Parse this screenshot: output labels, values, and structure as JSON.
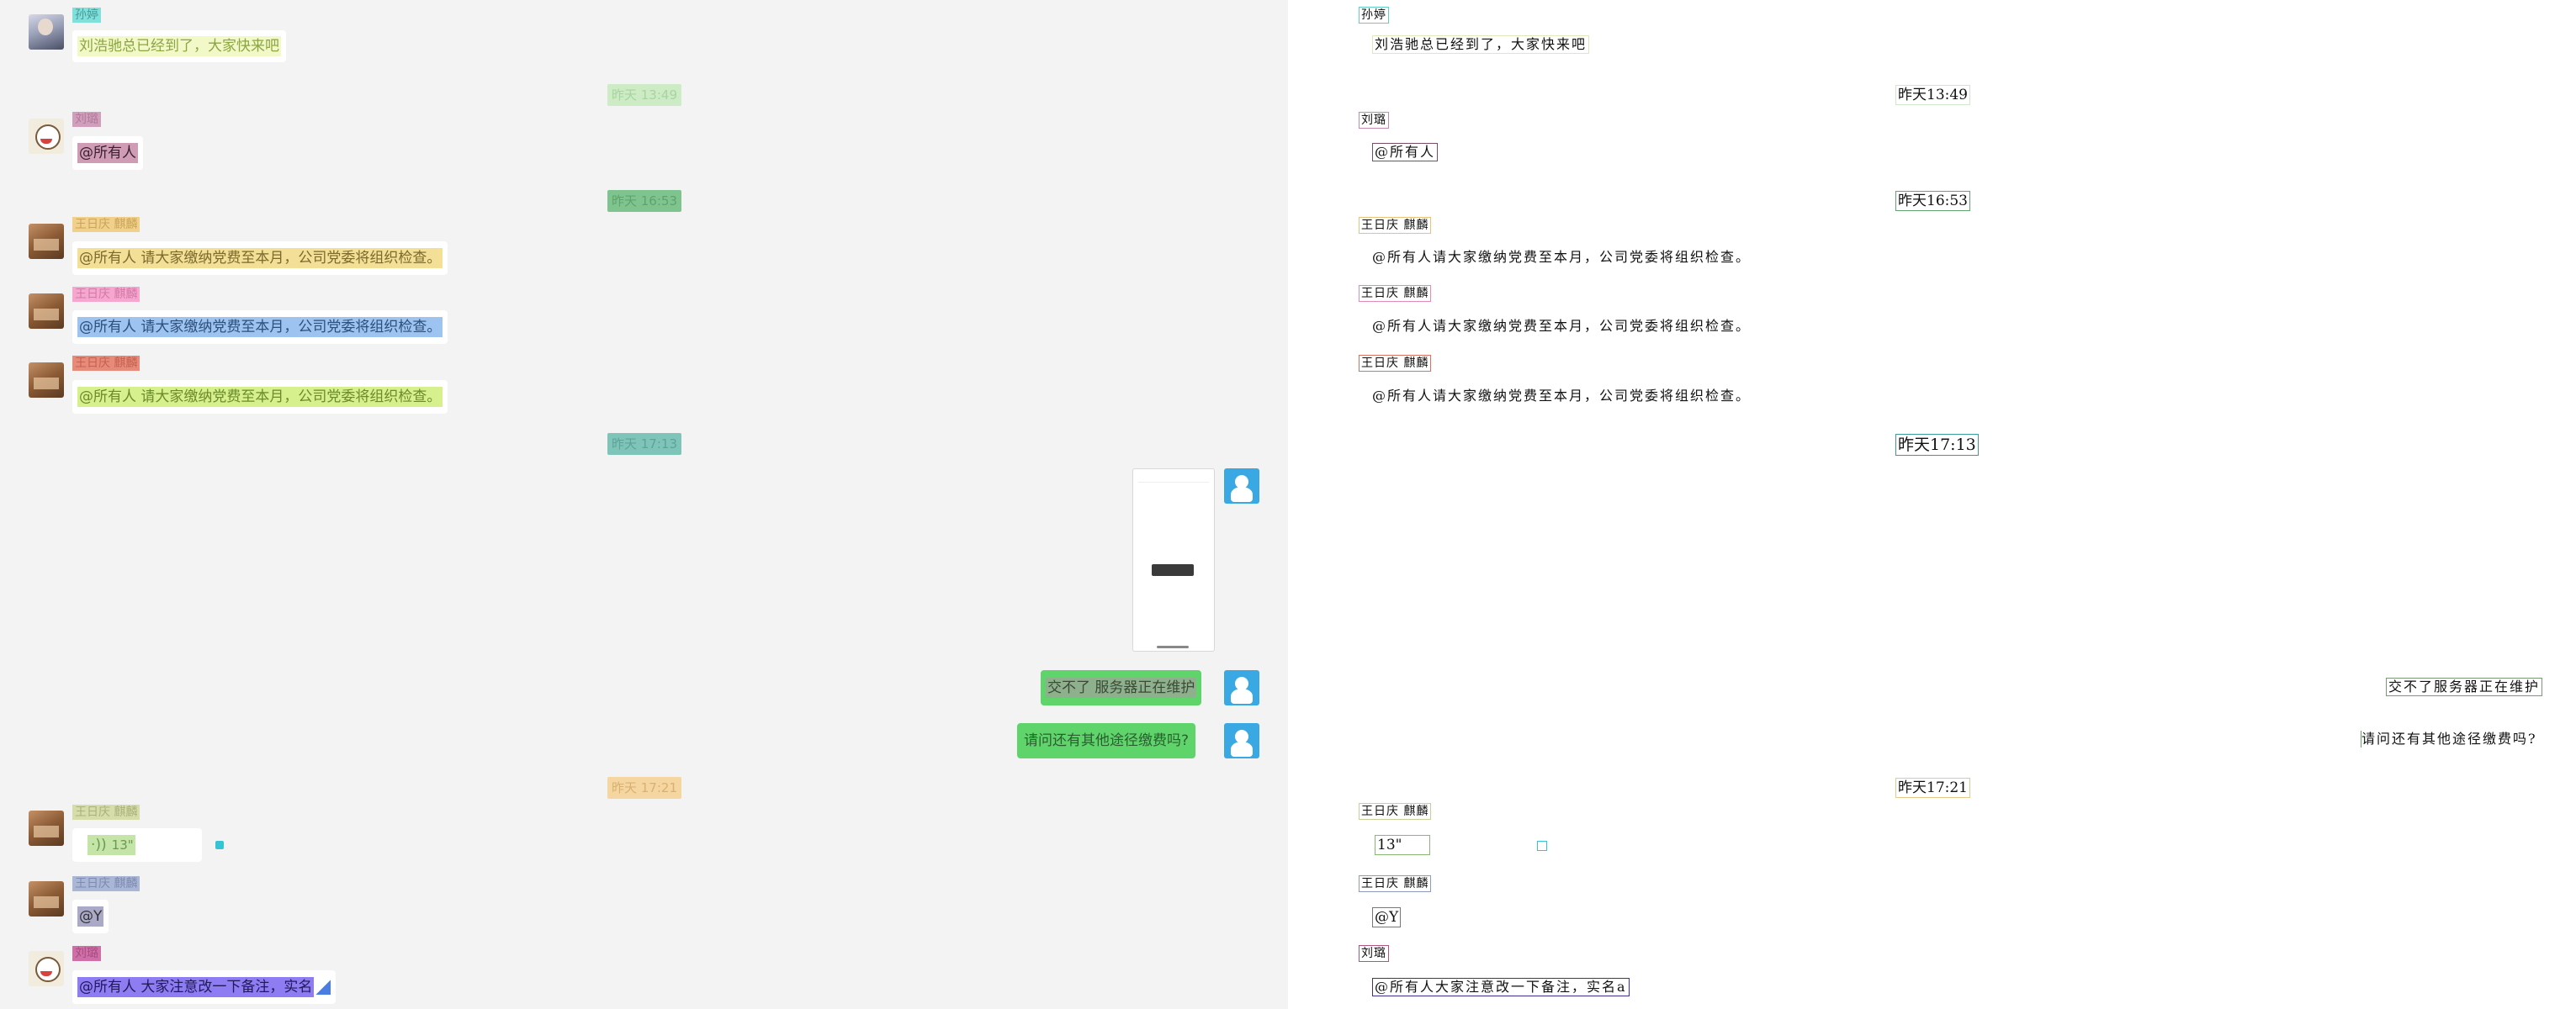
{
  "messages": {
    "m1": {
      "sender": "孙婷",
      "text": "刘浩驰总已经到了，大家快来吧"
    },
    "t1": "昨天 13:49",
    "m2": {
      "sender": "刘璐",
      "text": "@所有人"
    },
    "t2": "昨天 16:53",
    "m3": {
      "sender": "王日庆 麒麟",
      "text": "@所有人 请大家缴纳党费至本月，公司党委将组织检查。"
    },
    "m4": {
      "sender": "王日庆 麒麟",
      "text": "@所有人 请大家缴纳党费至本月，公司党委将组织检查。"
    },
    "m5": {
      "sender": "王日庆 麒麟",
      "text": "@所有人 请大家缴纳党费至本月，公司党委将组织检查。"
    },
    "t3": "昨天 17:13",
    "m6": {
      "text": "交不了 服务器正在维护"
    },
    "m7": {
      "text": "请问还有其他途径缴费吗?"
    },
    "t4": "昨天 17:21",
    "m8": {
      "sender": "王日庆 麒麟",
      "voice": "13\""
    },
    "m9": {
      "sender": "王日庆 麒麟",
      "text": "@Y"
    },
    "m10": {
      "sender": "刘璐",
      "text": "@所有人 大家注意改一下备注，实名"
    }
  },
  "right": {
    "m1_sender": "孙婷",
    "m1_text": "刘浩驰总已经到了，大家快来吧",
    "t1": "昨天13:49",
    "m2_sender": "刘璐",
    "m2_text": "@所有人",
    "t2": "昨天16:53",
    "m3_sender": "王日庆 麒麟",
    "m3_text": "@所有人请大家缴纳党费至本月，公司党委将组织检查。",
    "m4_sender": "王日庆 麒麟",
    "m4_text": "@所有人请大家缴纳党费至本月，公司党委将组织检查。",
    "m5_sender": "王日庆 麒麟",
    "m5_text": "@所有人请大家缴纳党费至本月，公司党委将组织检查。",
    "t3": "昨天17:13",
    "m6_text": "交不了服务器正在维护",
    "m7_text": "请问还有其他途径缴费吗?",
    "t4": "昨天17:21",
    "m8_sender": "王日庆 麒麟",
    "m8_voice": "13\"",
    "m9_sender": "王日庆 麒麟",
    "m9_text": "@Y",
    "m10_sender": "刘璐",
    "m10_text": "@所有人大家注意改一下备注，实名a"
  },
  "colors": {
    "own_bubble": "#5fd46b",
    "timestamp_pill": "#c8e6c9",
    "panel_bg": "#f3f3f3"
  }
}
